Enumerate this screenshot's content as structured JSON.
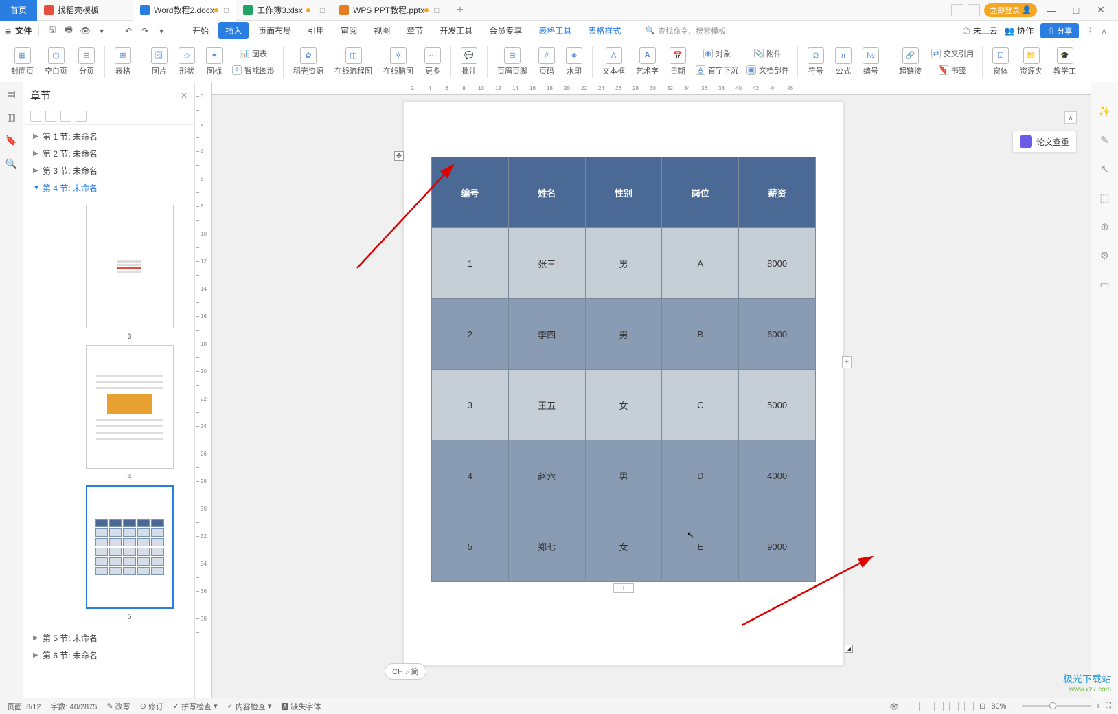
{
  "tabs": {
    "home": "首页",
    "docs": [
      {
        "icon": "red",
        "label": "找稻壳模板"
      },
      {
        "icon": "blue",
        "label": "Word教程2.docx",
        "active": true
      },
      {
        "icon": "green",
        "label": "工作簿3.xlsx"
      },
      {
        "icon": "orange",
        "label": "WPS PPT教程.pptx"
      }
    ]
  },
  "titleRight": {
    "login": "立即登录"
  },
  "menu": {
    "file": "文件",
    "tabs": [
      "开始",
      "插入",
      "页面布局",
      "引用",
      "审阅",
      "视图",
      "章节",
      "开发工具",
      "会员专享"
    ],
    "ctx": [
      "表格工具",
      "表格样式"
    ],
    "active": 1,
    "searchPh": "查找命令、搜索模板",
    "cloud": "未上云",
    "coop": "协作",
    "share": "分享"
  },
  "ribbon": {
    "groups": [
      "封面页",
      "空白页",
      "分页",
      "表格",
      "图片",
      "形状",
      "图标",
      "图表",
      "智能图形",
      "稻壳资源",
      "在线流程图",
      "在线脑图",
      "更多",
      "批注",
      "页眉页脚",
      "页码",
      "水印",
      "文本框",
      "艺术字",
      "日期",
      "对象",
      "首字下沉",
      "附件",
      "文档部件",
      "符号",
      "公式",
      "编号",
      "超链接",
      "交叉引用",
      "书签",
      "窗体",
      "资源夹",
      "教学工"
    ]
  },
  "chapterPanel": {
    "title": "章节",
    "sections": [
      {
        "label": "第 1 节: 未命名"
      },
      {
        "label": "第 2 节: 未命名"
      },
      {
        "label": "第 3 节: 未命名"
      },
      {
        "label": "第 4 节: 未命名",
        "expanded": true,
        "thumbs": [
          3,
          4,
          5
        ]
      },
      {
        "label": "第 5 节: 未命名"
      },
      {
        "label": "第 6 节: 未命名"
      }
    ]
  },
  "hruler": [
    "2",
    "4",
    "6",
    "8",
    "10",
    "12",
    "14",
    "16",
    "18",
    "20",
    "22",
    "24",
    "26",
    "28",
    "30",
    "32",
    "34",
    "36",
    "38",
    "40",
    "42",
    "44",
    "46"
  ],
  "table": {
    "headers": [
      "编号",
      "姓名",
      "性别",
      "岗位",
      "薪资"
    ],
    "rows": [
      {
        "cells": [
          "1",
          "张三",
          "男",
          "A",
          "8000"
        ],
        "cls": "alt"
      },
      {
        "cells": [
          "2",
          "李四",
          "男",
          "B",
          "6000"
        ],
        "cls": "norm"
      },
      {
        "cells": [
          "3",
          "王五",
          "女",
          "C",
          "5000"
        ],
        "cls": "alt"
      },
      {
        "cells": [
          "4",
          "赵六",
          "男",
          "D",
          "4000"
        ],
        "cls": "norm"
      },
      {
        "cells": [
          "5",
          "郑七",
          "女",
          "E",
          "9000"
        ],
        "cls": "norm"
      }
    ]
  },
  "paperCheck": "论文查重",
  "ime": "CH ♪ 简",
  "status": {
    "page": "页面: 8/12",
    "words": "字数: 40/2875",
    "rewrite": "改写",
    "revise": "修订",
    "spell": "拼写检查",
    "content": "内容检查",
    "font": "缺失字体",
    "zoom": "80%"
  },
  "watermark": {
    "l1": "极光下载站",
    "l2": "www.xz7.com"
  }
}
